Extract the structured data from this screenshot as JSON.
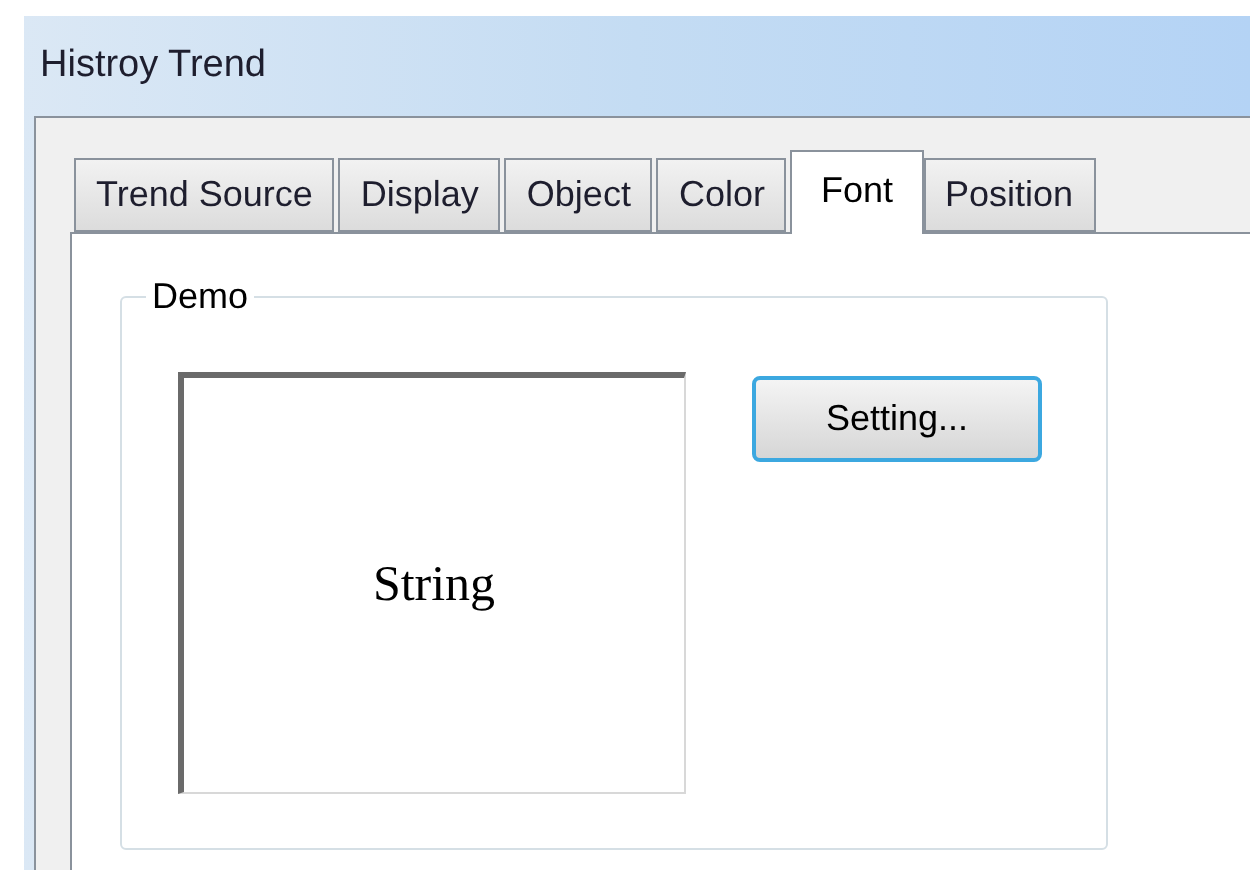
{
  "window": {
    "title": "Histroy Trend"
  },
  "tabs": [
    {
      "label": "Trend Source",
      "selected": false
    },
    {
      "label": "Display",
      "selected": false
    },
    {
      "label": "Object",
      "selected": false
    },
    {
      "label": "Color",
      "selected": false
    },
    {
      "label": "Font",
      "selected": true
    },
    {
      "label": "Position",
      "selected": false
    }
  ],
  "demo_group": {
    "title": "Demo",
    "preview_text": "String",
    "setting_button": "Setting..."
  }
}
